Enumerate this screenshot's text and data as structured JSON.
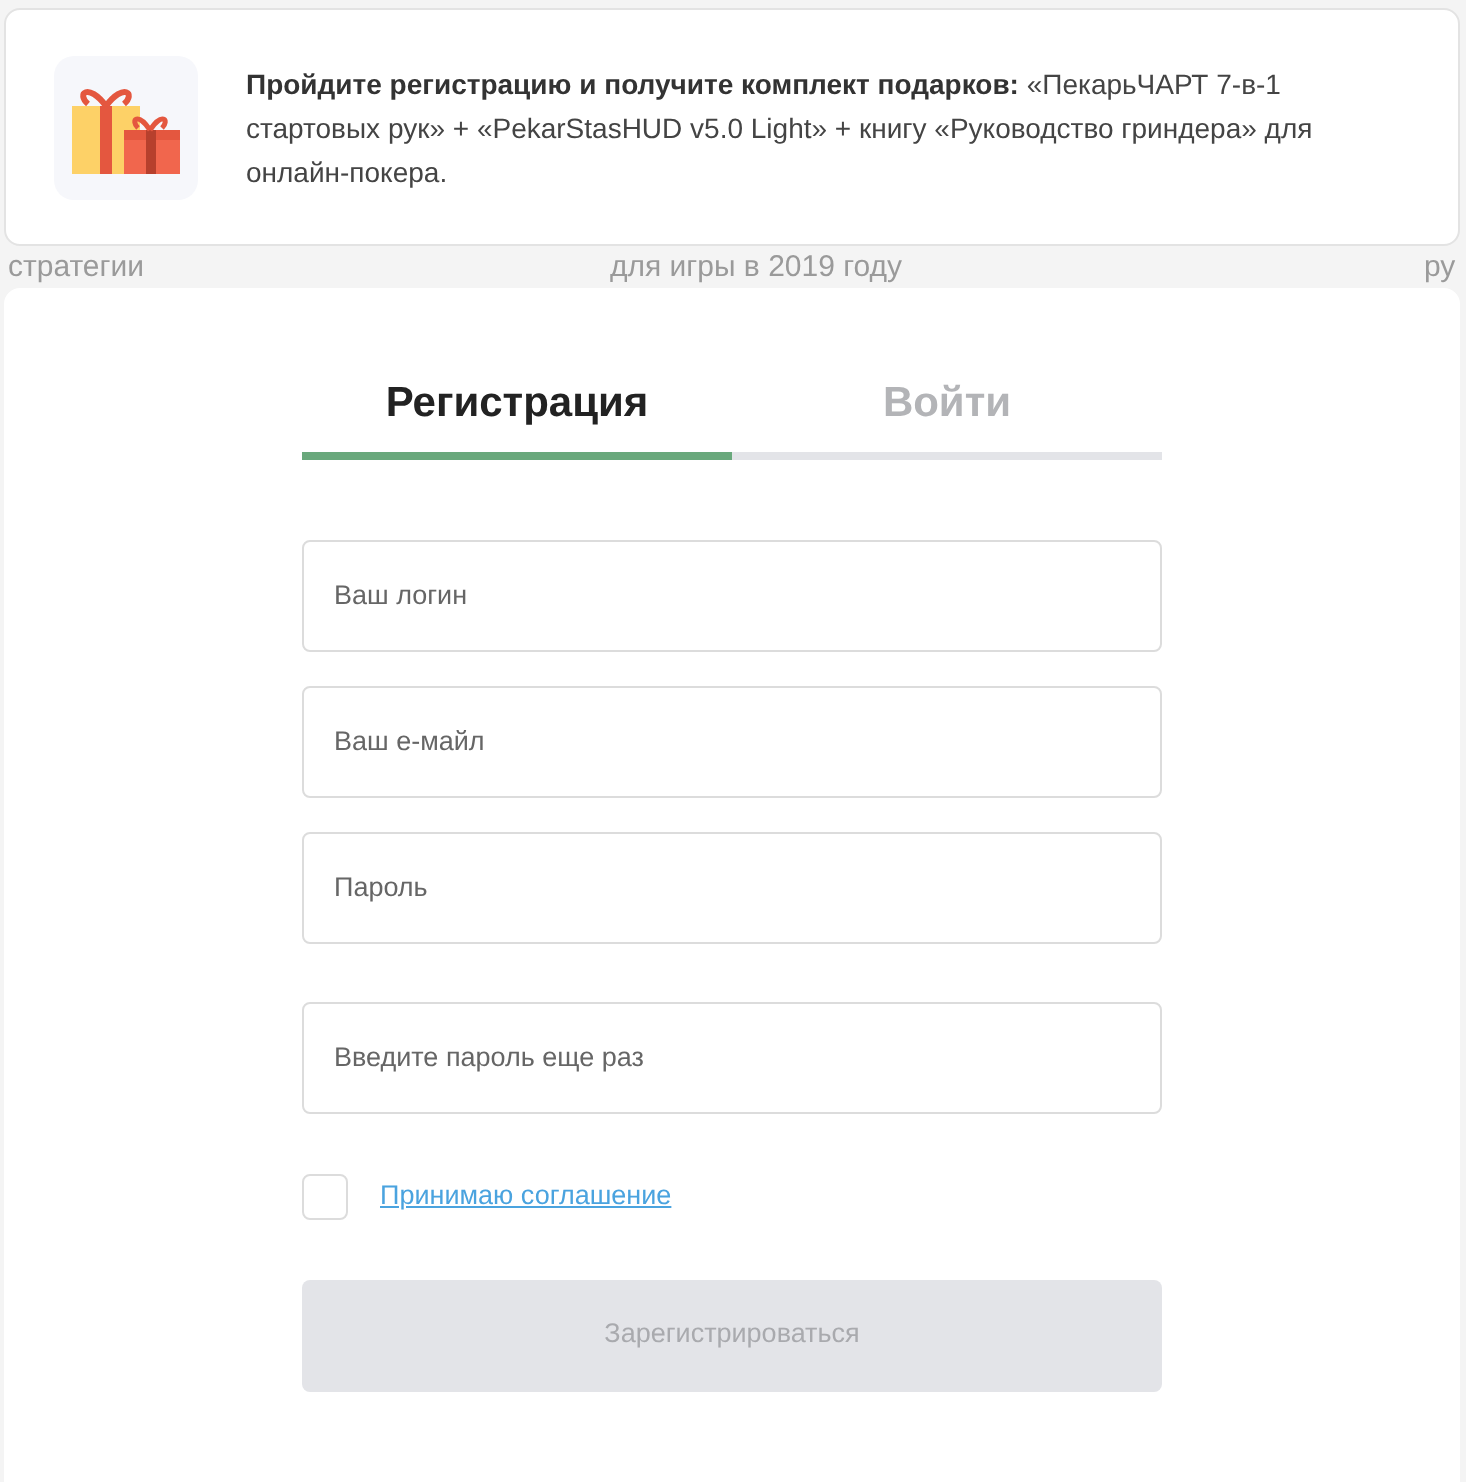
{
  "background_page": {
    "texts": [
      "стратегии",
      "для игры в 2019 году",
      "ру"
    ]
  },
  "promo_banner": {
    "lead": "Пройдите регистрацию и получите комплект подарков:",
    "text": "«ПекарьЧАРТ 7-в-1 стартовых рук» + «PekarStasHUD v5.0 Light» + книгу «Руководство гриндера» для онлайн-покера."
  },
  "tabs": [
    {
      "label": "Регистрация",
      "selected": true
    },
    {
      "label": "Войти",
      "selected": false
    }
  ],
  "fields": [
    {
      "placeholder": "Ваш логин"
    },
    {
      "placeholder": "Ваш е-майл"
    },
    {
      "placeholder": "Пароль"
    },
    {
      "placeholder": "Введите пароль еще раз"
    }
  ],
  "agreement": {
    "label": "Принимаю соглашение",
    "checked": false
  },
  "submit": {
    "label": "Зарегистрироваться",
    "disabled": true
  }
}
